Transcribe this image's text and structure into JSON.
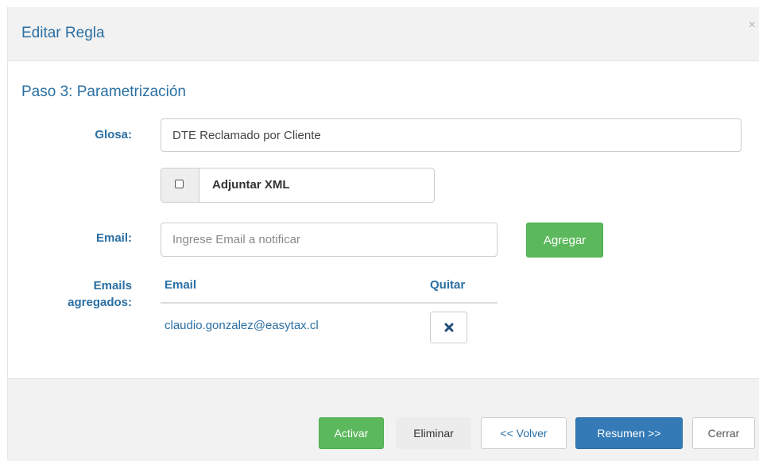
{
  "dialog": {
    "title": "Editar Regla",
    "close_symbol": "×"
  },
  "step": {
    "title": "Paso 3: Parametrización"
  },
  "form": {
    "glosa_label": "Glosa:",
    "glosa_value": "DTE Reclamado por Cliente",
    "attach_xml_label": "Adjuntar XML",
    "attach_xml_checked": false,
    "email_label": "Email:",
    "email_value": "",
    "email_placeholder": "Ingrese Email a notificar",
    "add_button_label": "Agregar"
  },
  "emails_table": {
    "section_label": "Emails agregados:",
    "headers": [
      "Email",
      "Quitar"
    ],
    "rows": [
      {
        "email": "claudio.gonzalez@easytax.cl",
        "remove_icon": "times-icon"
      }
    ]
  },
  "footer": {
    "buttons": [
      "Activar",
      "Eliminar",
      "<< Volver",
      "Resumen >>",
      "Cerrar"
    ]
  },
  "colors": {
    "accent_text": "#2a6fa3",
    "success": "#5cb85c",
    "primary": "#337ab7",
    "header_bg": "#f2f2f2"
  }
}
